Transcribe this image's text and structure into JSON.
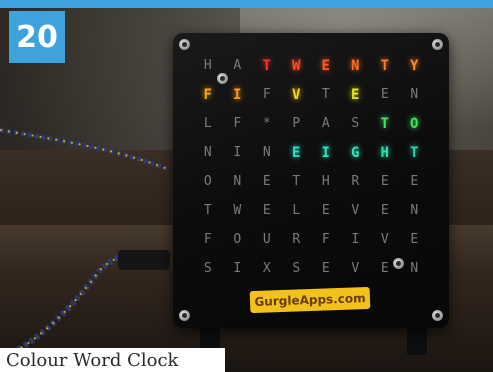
{
  "badge": {
    "number": "20"
  },
  "clock": {
    "rows": [
      [
        {
          "c": "H"
        },
        {
          "c": "A"
        },
        {
          "c": "T",
          "color": "#ff3030"
        },
        {
          "c": "W",
          "color": "#ff4a22"
        },
        {
          "c": "E",
          "color": "#ff5a1e"
        },
        {
          "c": "N",
          "color": "#ff6a1e"
        },
        {
          "c": "T",
          "color": "#ff7a1e"
        },
        {
          "c": "Y",
          "color": "#ff8a1a"
        }
      ],
      [
        {
          "c": "F",
          "color": "#ffa01a"
        },
        {
          "c": "I",
          "color": "#ff9a1a"
        },
        {
          "c": "F"
        },
        {
          "c": "V",
          "color": "#ffd21a"
        },
        {
          "c": "T"
        },
        {
          "c": "E",
          "color": "#e8e81a"
        },
        {
          "c": "E"
        },
        {
          "c": "N"
        }
      ],
      [
        {
          "c": "L"
        },
        {
          "c": "F"
        },
        {
          "c": "*"
        },
        {
          "c": "P"
        },
        {
          "c": "A"
        },
        {
          "c": "S"
        },
        {
          "c": "T",
          "color": "#3aea5a"
        },
        {
          "c": "O",
          "color": "#3aea5a"
        }
      ],
      [
        {
          "c": "N"
        },
        {
          "c": "I"
        },
        {
          "c": "N"
        },
        {
          "c": "E",
          "color": "#24e4c8"
        },
        {
          "c": "I",
          "color": "#28e6c0"
        },
        {
          "c": "G",
          "color": "#2ae6b8"
        },
        {
          "c": "H",
          "color": "#2ae2b0"
        },
        {
          "c": "T",
          "color": "#2ad8b0"
        }
      ],
      [
        {
          "c": "O"
        },
        {
          "c": "N"
        },
        {
          "c": "E"
        },
        {
          "c": "T"
        },
        {
          "c": "H"
        },
        {
          "c": "R"
        },
        {
          "c": "E"
        },
        {
          "c": "E"
        }
      ],
      [
        {
          "c": "T"
        },
        {
          "c": "W"
        },
        {
          "c": "E"
        },
        {
          "c": "L"
        },
        {
          "c": "E"
        },
        {
          "c": "V"
        },
        {
          "c": "E"
        },
        {
          "c": "N"
        }
      ],
      [
        {
          "c": "F"
        },
        {
          "c": "O"
        },
        {
          "c": "U"
        },
        {
          "c": "R"
        },
        {
          "c": "F"
        },
        {
          "c": "I"
        },
        {
          "c": "V"
        },
        {
          "c": "E"
        }
      ],
      [
        {
          "c": "S"
        },
        {
          "c": "I"
        },
        {
          "c": "X"
        },
        {
          "c": "S"
        },
        {
          "c": "E"
        },
        {
          "c": "V"
        },
        {
          "c": "E"
        },
        {
          "c": "N"
        }
      ]
    ],
    "logo": "GurgleApps.com"
  },
  "caption": {
    "text": "Colour Word Clock"
  },
  "colors": {
    "accent": "#3ea2dc",
    "unlit": "#7a7a7a",
    "logo_bg": "#f2c21a"
  }
}
